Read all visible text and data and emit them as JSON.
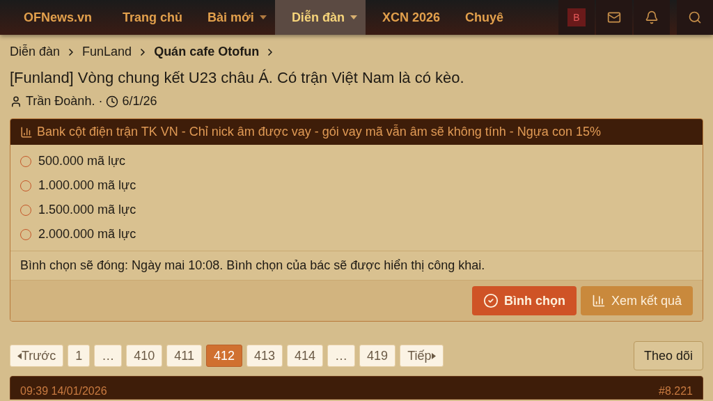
{
  "nav": {
    "logo": "OFNews.vn",
    "items": [
      {
        "label": "Trang chủ",
        "selected": false,
        "dropdown": false
      },
      {
        "label": "Bài mới",
        "selected": false,
        "dropdown": true
      },
      {
        "label": "Diễn đàn",
        "selected": true,
        "dropdown": true
      },
      {
        "label": "XCN 2026",
        "selected": false,
        "dropdown": false
      },
      {
        "label": "Chuyê",
        "selected": false,
        "dropdown": false
      }
    ],
    "avatar": "B"
  },
  "breadcrumb": [
    {
      "label": "Diễn đàn",
      "current": false
    },
    {
      "label": "FunLand",
      "current": false
    },
    {
      "label": "Quán cafe Otofun",
      "current": true
    }
  ],
  "thread": {
    "title": "[Funland] Vòng chung kết U23 châu Á. Có trận Việt Nam là có kèo.",
    "author": "Trần Đoành.",
    "separator": "·",
    "date": "6/1/26"
  },
  "poll": {
    "title": "Bank cột điện trận TK VN - Chỉ nick âm được vay - gói vay mã vẫn âm sẽ không tính - Ngựa con 15%",
    "options": [
      {
        "label": "500.000 mã lực",
        "selected": false
      },
      {
        "label": "1.000.000 mã lực",
        "selected": false
      },
      {
        "label": "1.500.000 mã lực",
        "selected": false
      },
      {
        "label": "2.000.000 mã lực",
        "selected": false
      }
    ],
    "note": "Bình chọn sẽ đóng: Ngày mai 10:08. Bình chọn của bác sẽ được hiển thị công khai.",
    "vote_button": "Bình chọn",
    "results_button": "Xem kết quả"
  },
  "pagination": {
    "prev": "Trước",
    "next": "Tiếp",
    "pages": [
      {
        "label": "1",
        "selected": false
      },
      {
        "label": "…",
        "selected": false
      },
      {
        "label": "410",
        "selected": false
      },
      {
        "label": "411",
        "selected": false
      },
      {
        "label": "412",
        "selected": true
      },
      {
        "label": "413",
        "selected": false
      },
      {
        "label": "414",
        "selected": false
      },
      {
        "label": "…",
        "selected": false
      },
      {
        "label": "419",
        "selected": false
      }
    ]
  },
  "watch_button": "Theo dõi",
  "post": {
    "time": "09:39 14/01/2026",
    "number": "#8.221"
  }
}
